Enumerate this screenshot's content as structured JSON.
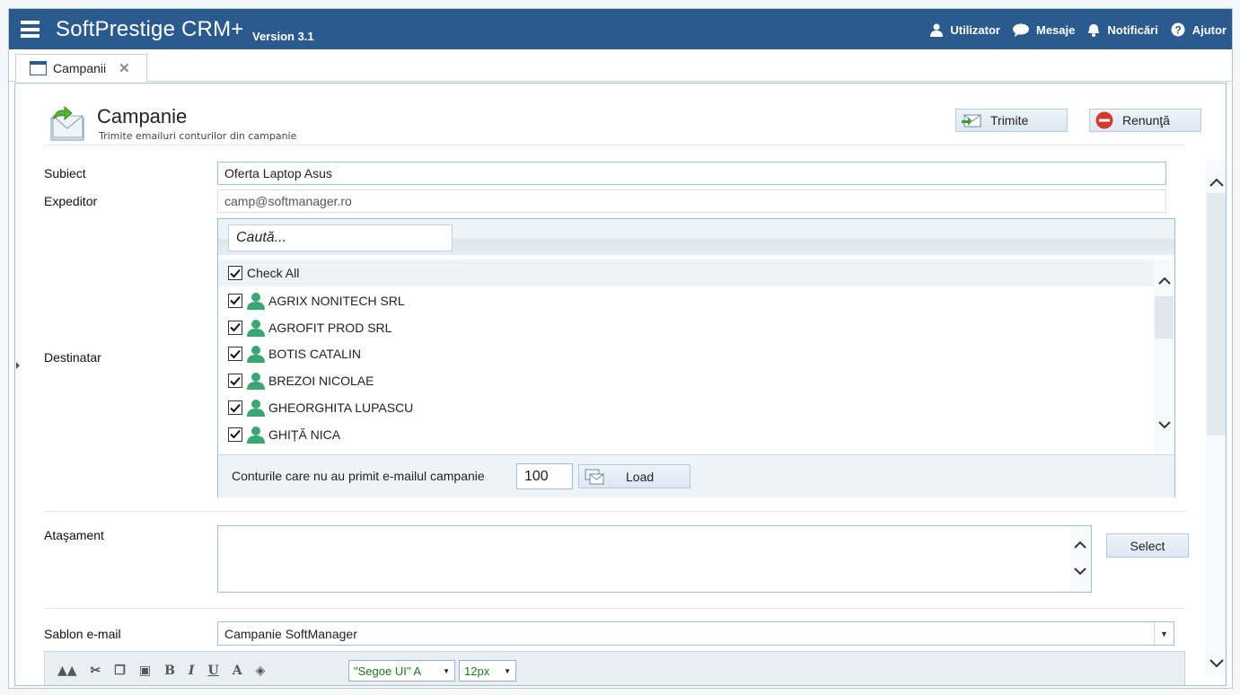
{
  "header": {
    "app_title": "SoftPrestige CRM+",
    "version": "Version 3.1",
    "menu": [
      {
        "label": "Utilizator",
        "icon": "user-icon"
      },
      {
        "label": "Mesaje",
        "icon": "chat-bubble-icon"
      },
      {
        "label": "Notificări",
        "icon": "bell-icon"
      },
      {
        "label": "Ajutor",
        "icon": "help-icon"
      }
    ]
  },
  "tabs": [
    {
      "label": "Campanii",
      "icon": "window-icon",
      "active": true
    }
  ],
  "page": {
    "title": "Campanie",
    "subtitle": "Trimite emailuri conturilor din campanie",
    "actions": {
      "send_label": "Trimite",
      "cancel_label": "Renunţă"
    }
  },
  "form": {
    "subject_label": "Subiect",
    "subject_value": "Oferta Laptop Asus",
    "sender_label": "Expeditor",
    "sender_value": "camp@softmanager.ro",
    "recipient_label": "Destinatar",
    "recipients": {
      "search_placeholder": "Caută...",
      "check_all_label": "Check All",
      "check_all_checked": true,
      "items": [
        {
          "name": "AGRIX NONITECH SRL",
          "checked": true
        },
        {
          "name": "AGROFIT PROD SRL",
          "checked": true
        },
        {
          "name": "BOTIS CATALIN",
          "checked": true
        },
        {
          "name": "BREZOI NICOLAE",
          "checked": true
        },
        {
          "name": "GHEORGHITA LUPASCU",
          "checked": true
        },
        {
          "name": "GHIȚĂ NICA",
          "checked": true
        }
      ],
      "not_received_label": "Conturile care nu au primit e-mailul campanie",
      "not_received_count": "100",
      "load_label": "Load"
    },
    "attachment_label": "Ataşament",
    "attachment_select_label": "Select",
    "template_label": "Sablon e-mail",
    "template_value": "Campanie SoftManager",
    "editor_toolbar": {
      "bold_label": "B",
      "italic_label": "I",
      "underline_label": "U",
      "color_label": "A",
      "font_family": "\"Segoe UI\" A",
      "font_size": "12px"
    }
  },
  "colors": {
    "header_bg": "#2a5a8e",
    "border_accent": "#9ac0de",
    "person_icon": "#3aa672",
    "cancel_icon": "#d23b2d"
  }
}
